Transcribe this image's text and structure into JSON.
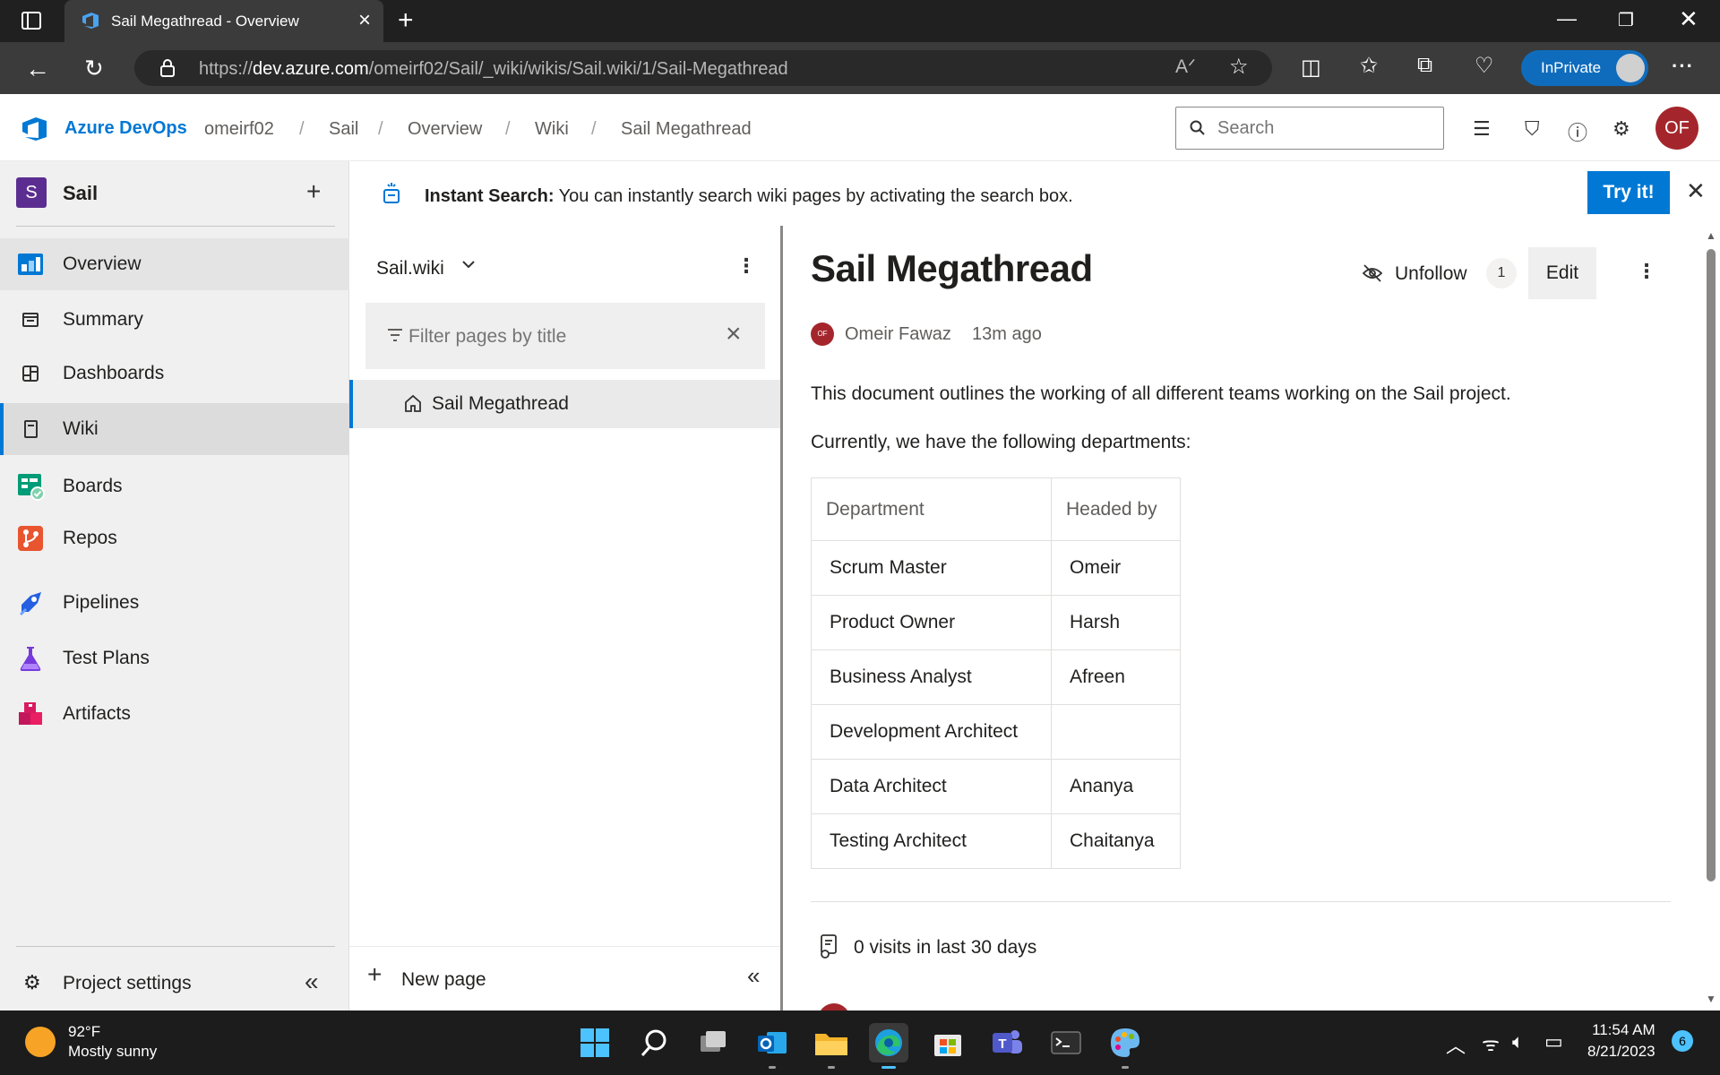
{
  "browser": {
    "tab_title": "Sail Megathread - Overview",
    "url_prefix": "https://",
    "url_host": "dev.azure.com",
    "url_path": "/omeirf02/Sail/_wiki/wikis/Sail.wiki/1/Sail-Megathread",
    "inprivate_label": "InPrivate"
  },
  "header": {
    "brand": "Azure DevOps",
    "breadcrumbs": [
      "omeirf02",
      "Sail",
      "Overview",
      "Wiki",
      "Sail Megathread"
    ],
    "search_placeholder": "Search",
    "avatar_initials": "OF"
  },
  "sidebar": {
    "project_badge": "S",
    "project_name": "Sail",
    "items": [
      {
        "label": "Overview",
        "icon": "overview-icon"
      },
      {
        "label": "Summary",
        "icon": "summary-icon"
      },
      {
        "label": "Dashboards",
        "icon": "dashboards-icon"
      },
      {
        "label": "Wiki",
        "icon": "wiki-icon"
      },
      {
        "label": "Boards",
        "icon": "boards-icon"
      },
      {
        "label": "Repos",
        "icon": "repos-icon"
      },
      {
        "label": "Pipelines",
        "icon": "pipelines-icon"
      },
      {
        "label": "Test Plans",
        "icon": "test-plans-icon"
      },
      {
        "label": "Artifacts",
        "icon": "artifacts-icon"
      }
    ],
    "settings_label": "Project settings"
  },
  "banner": {
    "bold": "Instant Search:",
    "text": " You can instantly search wiki pages by activating the search box.",
    "button": "Try it!"
  },
  "tree": {
    "wiki_name": "Sail.wiki",
    "filter_placeholder": "Filter pages by title",
    "pages": [
      "Sail Megathread"
    ],
    "new_page_label": "New page"
  },
  "page": {
    "title": "Sail Megathread",
    "unfollow_label": "Unfollow",
    "follower_count": "1",
    "edit_label": "Edit",
    "author_initials": "OF",
    "author_name": "Omeir Fawaz",
    "modified": "13m ago",
    "para1": "This document outlines the working of all different teams working on the Sail project.",
    "para2": "Currently, we have the following departments:",
    "table_headers": [
      "Department",
      "Headed by"
    ],
    "table_rows": [
      [
        "Scrum Master",
        "Omeir"
      ],
      [
        "Product Owner",
        "Harsh"
      ],
      [
        "Business Analyst",
        "Afreen"
      ],
      [
        "Development Architect",
        ""
      ],
      [
        "Data Architect",
        "Ananya"
      ],
      [
        "Testing Architect",
        "Chaitanya"
      ]
    ],
    "visits": "0 visits in last 30 days"
  },
  "taskbar": {
    "temperature": "92°F",
    "weather": "Mostly sunny",
    "time": "11:54 AM",
    "date": "8/21/2023",
    "notifications": "6"
  },
  "colors": {
    "accent": "#0078d4",
    "avatar": "#a4262c",
    "project_badge": "#5c2d91"
  }
}
